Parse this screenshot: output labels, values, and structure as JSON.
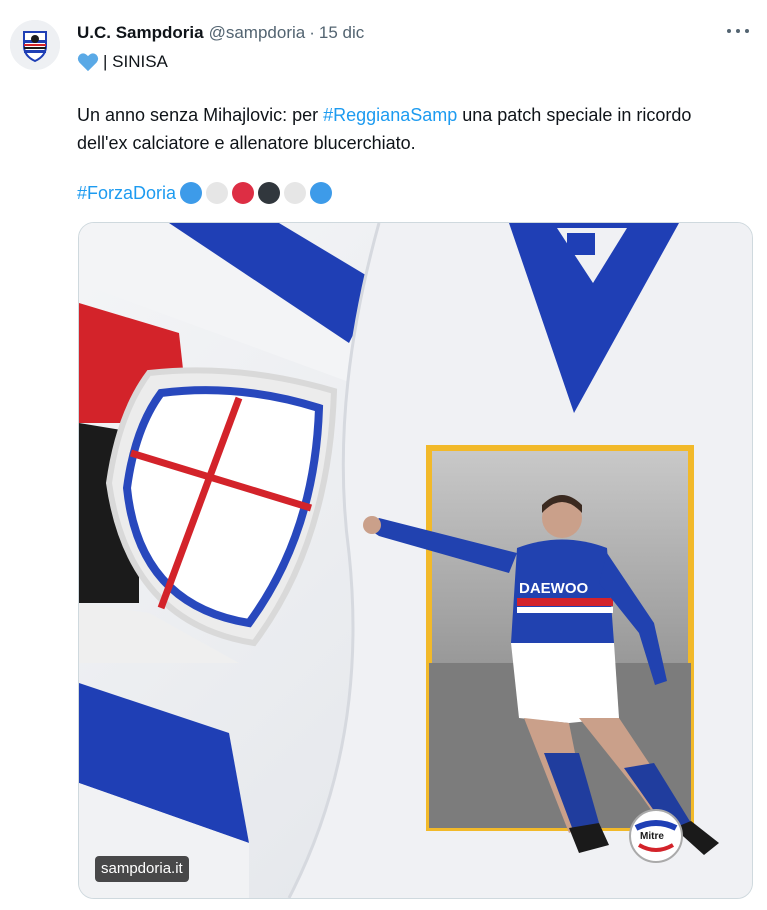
{
  "author": {
    "name": "U.C. Sampdoria",
    "handle": "@sampdoria",
    "separator": "·",
    "date": "15 dic",
    "bio": "| SINISA",
    "avatar_icon": "sampdoria-crest-icon",
    "heart_color": "#5aa9e6"
  },
  "post": {
    "text_before": "Un anno senza Mihajlovic: per ",
    "hashtag1": "#ReggianaSamp",
    "text_after": " una patch speciale in ricordo dell'ex calciatore e allenatore blucerchiato.",
    "hashtag2": "#ForzaDoria",
    "emoji_circles": [
      "#3d9be9",
      "#e6e6e6",
      "#dd2e44",
      "#31373d",
      "#e6e6e6",
      "#3d9be9"
    ]
  },
  "media": {
    "watermark": "sampdoria.it",
    "jersey_sponsor": "DAEWOO",
    "ball_brand": "Mitre",
    "colors": {
      "blue": "#1f3fb5",
      "red": "#d3232a",
      "black": "#1b1b1b",
      "frame": "#f2b929"
    }
  },
  "ui": {
    "more_icon": "more-options-icon"
  }
}
